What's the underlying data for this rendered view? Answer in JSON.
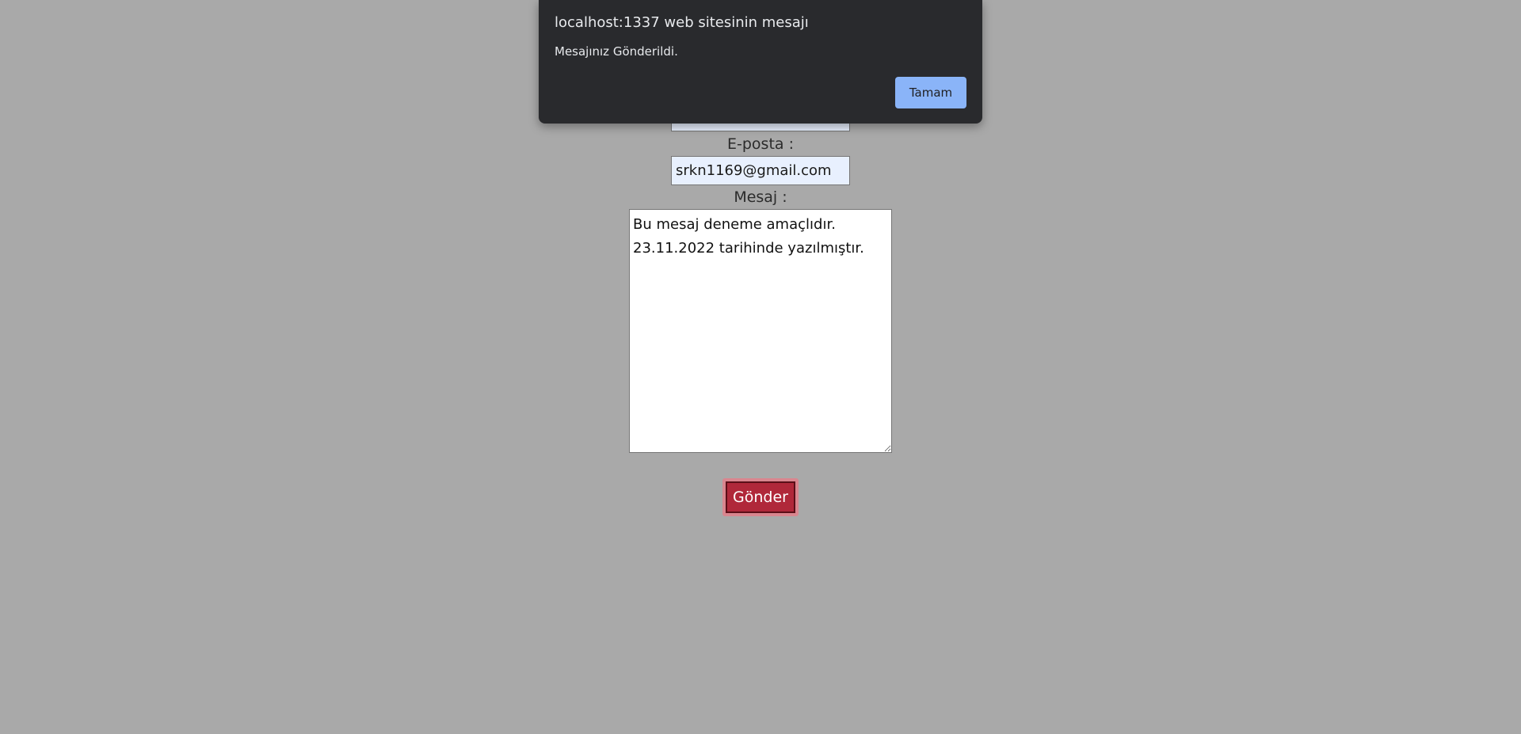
{
  "form": {
    "name_value": "",
    "email_label": "E-posta :",
    "email_value": "srkn1169@gmail.com",
    "message_label": "Mesaj :",
    "message_value": "Bu mesaj deneme amaçlıdır.\n23.11.2022 tarihinde yazılmıştır.",
    "submit_label": "Gönder"
  },
  "dialog": {
    "title": "localhost:1337 web sitesinin mesajı",
    "message": "Mesajınız Gönderildi.",
    "ok_label": "Tamam"
  },
  "colors": {
    "background": "#a9a9a9",
    "dialog_bg": "#292a2d",
    "ok_button": "#8ab4f8",
    "submit_button": "#b0283a"
  }
}
